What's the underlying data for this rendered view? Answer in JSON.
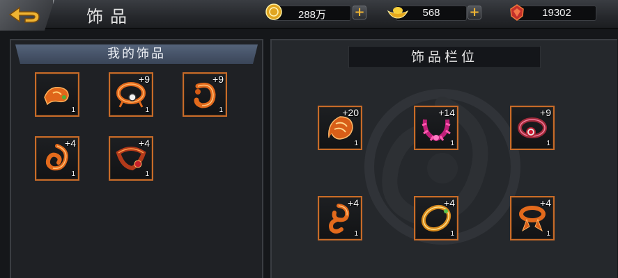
{
  "header": {
    "title": "饰品",
    "back_icon": "back-arrow-icon",
    "currencies": [
      {
        "name": "coin",
        "icon": "gold-coin-icon",
        "value": "288万"
      },
      {
        "name": "ingot",
        "icon": "gold-ingot-icon",
        "value": "568"
      },
      {
        "name": "gem",
        "icon": "red-gem-icon",
        "value": "19302"
      }
    ],
    "add_label": "+"
  },
  "left_panel": {
    "title": "我的饰品",
    "items": [
      {
        "icon": "orange-dragon-brooch-icon",
        "enhance": "",
        "count": "1"
      },
      {
        "icon": "orange-ring-with-pearl-icon",
        "enhance": "+9",
        "count": "1"
      },
      {
        "icon": "orange-hook-bracelet-icon",
        "enhance": "+9",
        "count": "1"
      },
      {
        "icon": "orange-spiral-pendant-icon",
        "enhance": "+4",
        "count": "1"
      },
      {
        "icon": "red-dragon-necklace-icon",
        "enhance": "+4",
        "count": "1"
      }
    ]
  },
  "right_panel": {
    "title": "饰品栏位",
    "emblem_icon": "dragon-emblem-icon",
    "slots": [
      {
        "icon": "orange-phoenix-emblem-icon",
        "enhance": "+20",
        "count": "1"
      },
      {
        "icon": "pink-crystal-necklace-icon",
        "enhance": "+14",
        "count": "1"
      },
      {
        "icon": "red-gem-ring-icon",
        "enhance": "+9",
        "count": "1"
      },
      {
        "icon": "orange-swirl-charm-icon",
        "enhance": "+4",
        "count": "1"
      },
      {
        "icon": "gold-bangle-icon",
        "enhance": "+4",
        "count": "1"
      },
      {
        "icon": "orange-ribbon-ring-icon",
        "enhance": "+4",
        "count": "1"
      }
    ]
  },
  "colors": {
    "slot_border": "#c86b28",
    "accent_gold": "#f0b432",
    "header_blue": "#4a566b"
  }
}
